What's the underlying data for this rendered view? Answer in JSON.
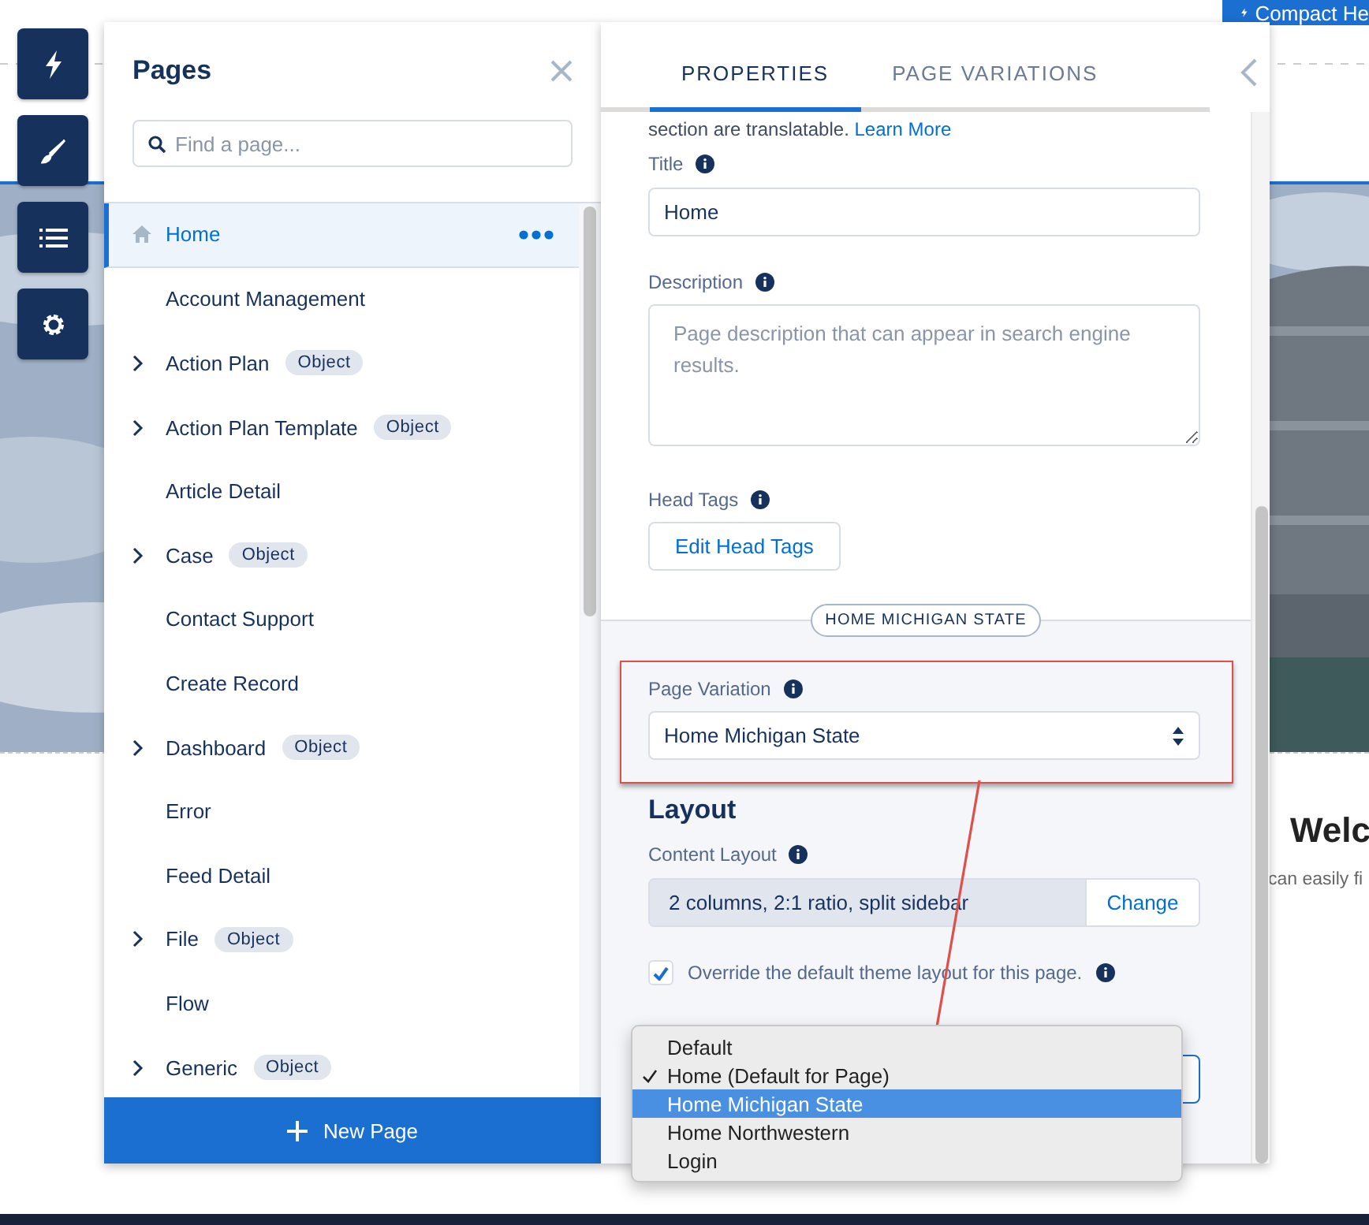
{
  "site": {
    "header_button": "Compact He",
    "heading": "Welc",
    "text": "can easily fi"
  },
  "pages_panel": {
    "title": "Pages",
    "search": {
      "placeholder": "Find a page..."
    },
    "items": [
      {
        "label": "Home",
        "selected": true,
        "expandable": false
      },
      {
        "label": "Account Management",
        "selected": false,
        "expandable": false
      },
      {
        "label": "Action Plan",
        "selected": false,
        "expandable": true,
        "badge": "Object"
      },
      {
        "label": "Action Plan Template",
        "selected": false,
        "expandable": true,
        "badge": "Object"
      },
      {
        "label": "Article Detail",
        "selected": false,
        "expandable": false
      },
      {
        "label": "Case",
        "selected": false,
        "expandable": true,
        "badge": "Object"
      },
      {
        "label": "Contact Support",
        "selected": false,
        "expandable": false
      },
      {
        "label": "Create Record",
        "selected": false,
        "expandable": false
      },
      {
        "label": "Dashboard",
        "selected": false,
        "expandable": true,
        "badge": "Object"
      },
      {
        "label": "Error",
        "selected": false,
        "expandable": false
      },
      {
        "label": "Feed Detail",
        "selected": false,
        "expandable": false
      },
      {
        "label": "File",
        "selected": false,
        "expandable": true,
        "badge": "Object"
      },
      {
        "label": "Flow",
        "selected": false,
        "expandable": false
      },
      {
        "label": "Generic",
        "selected": false,
        "expandable": true,
        "badge": "Object"
      }
    ],
    "new_page_button": "New Page"
  },
  "properties_panel": {
    "tabs": [
      {
        "label": "PROPERTIES",
        "selected": true
      },
      {
        "label": "PAGE VARIATIONS",
        "selected": false
      }
    ],
    "intro_text": "section are translatable.",
    "learn_more_link": "Learn More",
    "title_field": {
      "label": "Title",
      "value": "Home"
    },
    "description_field": {
      "label": "Description",
      "placeholder": "Page description that can appear in search engine results."
    },
    "head_tags": {
      "label": "Head Tags",
      "button": "Edit Head Tags"
    },
    "variation_badge": "HOME MICHIGAN STATE",
    "page_variation": {
      "label": "Page Variation",
      "value": "Home Michigan State"
    },
    "layout_heading": "Layout",
    "content_layout": {
      "label": "Content Layout",
      "value": "2 columns, 2:1 ratio, split sidebar",
      "button": "Change"
    },
    "override": {
      "label": "Override the default theme layout for this page.",
      "checked": true
    },
    "theme_layout_menu": {
      "options": [
        {
          "label": "Default",
          "checked": false,
          "selected": false
        },
        {
          "label": "Home (Default for Page)",
          "checked": true,
          "selected": false
        },
        {
          "label": "Home Michigan State",
          "checked": false,
          "selected": true
        },
        {
          "label": "Home Northwestern",
          "checked": false,
          "selected": false
        },
        {
          "label": "Login",
          "checked": false,
          "selected": false
        }
      ]
    }
  }
}
